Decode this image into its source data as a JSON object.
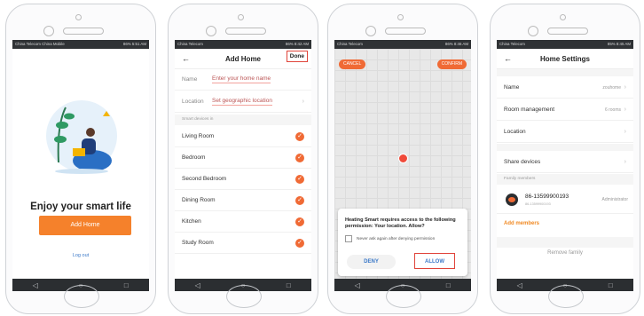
{
  "status_bar": {
    "s1_left": "China Telecom China Mobile",
    "s1_right": "86% 5:51 AM",
    "s2_left": "China Telecom",
    "s2_right": "86% 8:42 AM",
    "s3_left": "China Telecom",
    "s3_right": "86% 8:46 AM",
    "s4_left": "China Telecom",
    "s4_right": "85% 8:45 AM"
  },
  "screen1": {
    "title": "Enjoy your smart life",
    "add_home_button": "Add Home",
    "logout_link": "Log out"
  },
  "screen2": {
    "title": "Add Home",
    "back_icon": "←",
    "done_label": "Done",
    "name_label": "Name",
    "name_placeholder": "Enter your home name",
    "location_label": "Location",
    "location_value": "Set geographic location",
    "section_label": "Smart devices in",
    "rooms": [
      "Living Room",
      "Bedroom",
      "Second Bedroom",
      "Dining Room",
      "Kitchen",
      "Study Room"
    ]
  },
  "screen3": {
    "cancel_label": "CANCEL",
    "confirm_label": "CONFIRM",
    "dialog_message": "Heating Smart requires access to the following permission: Your location. Allow?",
    "checkbox_label": "Never ask again after denying permission",
    "deny_label": "DENY",
    "allow_label": "ALLOW"
  },
  "screen4": {
    "title": "Home Settings",
    "back_icon": "←",
    "name_label": "Name",
    "name_value": "zouhome",
    "room_mgmt_label": "Room management",
    "room_mgmt_value": "6 rooms",
    "location_label": "Location",
    "share_devices_label": "Share devices",
    "family_section": "Family members",
    "member_phone": "86-13599900193",
    "member_sub": "86-13599900193",
    "member_role": "Administrator",
    "add_members_label": "Add members",
    "remove_family_label": "Remove family"
  },
  "icons": {
    "check": "✓",
    "chevron": "›",
    "nav_back": "◁",
    "nav_home": "○",
    "nav_recent": "□"
  },
  "colors": {
    "accent_orange": "#f5812b",
    "highlight_red": "#e0443a",
    "link_blue": "#3a78c8"
  }
}
